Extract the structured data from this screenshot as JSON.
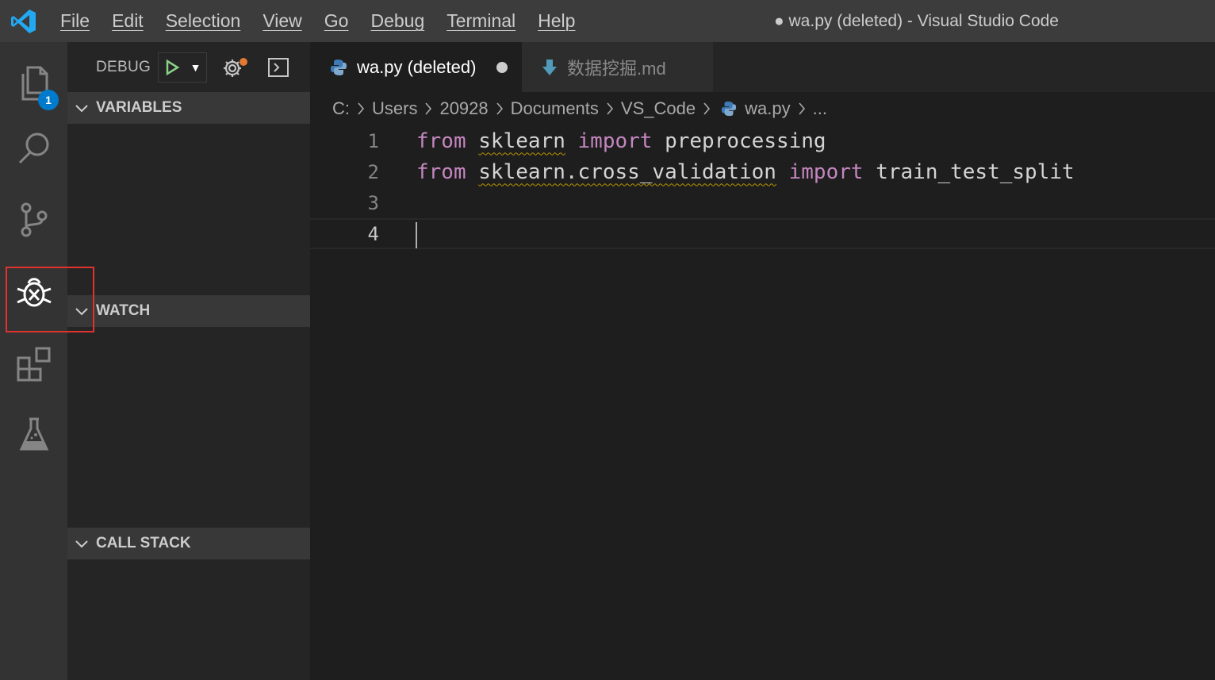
{
  "window": {
    "title": "● wa.py (deleted) - Visual Studio Code"
  },
  "menu": [
    "File",
    "Edit",
    "Selection",
    "View",
    "Go",
    "Debug",
    "Terminal",
    "Help"
  ],
  "activity_bar": {
    "items": [
      {
        "name": "explorer-icon",
        "badge": "1"
      },
      {
        "name": "search-icon"
      },
      {
        "name": "source-control-icon"
      },
      {
        "name": "debug-icon",
        "active": true,
        "highlighted": true
      },
      {
        "name": "extensions-icon"
      },
      {
        "name": "test-flask-icon"
      }
    ],
    "highlight_color": "#e0322e"
  },
  "sidebar": {
    "debug_label": "DEBUG",
    "sections": {
      "variables": "VARIABLES",
      "watch": "WATCH",
      "call_stack": "CALL STACK"
    }
  },
  "tabs": [
    {
      "label": "wa.py (deleted)",
      "icon": "python-icon",
      "active": true,
      "dirty": true
    },
    {
      "label": "数据挖掘.md",
      "icon": "markdown-arrow-icon",
      "active": false
    }
  ],
  "breadcrumb": [
    "C:",
    "Users",
    "20928",
    "Documents",
    "VS_Code",
    "wa.py",
    "..."
  ],
  "code": {
    "line_numbers": [
      "1",
      "2",
      "3",
      "4"
    ],
    "line1": {
      "kw1": "from",
      "mod": "sklearn",
      "kw2": "import",
      "name": "preprocessing"
    },
    "line2": {
      "kw1": "from",
      "mod": "sklearn.cross_validation",
      "kw2": "import",
      "name": "train_test_split"
    }
  },
  "colors": {
    "keyword": "#c586c0",
    "accent": "#007acc",
    "editor_bg": "#1e1e1e",
    "sidebar_bg": "#252526",
    "activity_bg": "#333333",
    "titlebar_bg": "#3c3c3c"
  }
}
